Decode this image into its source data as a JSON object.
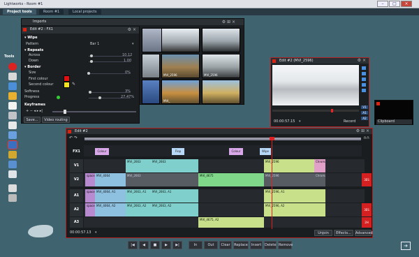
{
  "window": {
    "app_title": "Lightworks - Room #1",
    "controls": [
      "minimize",
      "maximize",
      "close"
    ]
  },
  "tabs": [
    "Project tools",
    "Room #1",
    "Local projects"
  ],
  "toolbox": {
    "label": "Tools"
  },
  "effects_panel": {
    "title": "Edit #2 : FX1",
    "section_wipe": "Wipe",
    "pattern_label": "Pattern",
    "pattern_value": "Bar 1",
    "repeats_label": "Repeats",
    "across_label": "Across",
    "across_value": "10.12",
    "down_label": "Down",
    "down_value": "1.00",
    "border_label": "Border",
    "size_label": "Size",
    "size_value": "0%",
    "first_colour_label": "First colour",
    "second_colour_label": "Second colour",
    "softness_label": "Softness",
    "softness_value": "3%",
    "progress_label": "Progress",
    "progress_value": "27.47%",
    "keyframes_label": "Keyframes",
    "save_label": "Save...",
    "routing_label": "Video routing",
    "first_colour": "#e01010",
    "second_colour": "#f0e020"
  },
  "imports": {
    "title": "Imports",
    "thumbs": [
      {
        "caption": ""
      },
      {
        "caption": ""
      },
      {
        "caption": ""
      },
      {
        "caption": ""
      },
      {
        "caption": "MVI_2596"
      },
      {
        "caption": "MVI_2596"
      },
      {
        "caption": ""
      },
      {
        "caption": "MVI_"
      },
      {
        "caption": ""
      }
    ]
  },
  "viewer": {
    "title": "Edit #2 (MVI_2596)",
    "timecode": "00:00:57.15",
    "record_label": "Record",
    "side_tags": [
      "V1",
      "A1",
      "A2"
    ]
  },
  "clipboard": {
    "label": "Clipboard"
  },
  "timeline": {
    "title": "Edit #2",
    "timecode": "00:00:57.13",
    "fx_track": "FX1",
    "fx_clips": [
      "Colour",
      "Flop",
      "Colour",
      "Wipe"
    ],
    "tracks": [
      {
        "name": "V1",
        "clips": [
          "MVI_2663",
          "MVI_2663",
          "MVI_2596",
          "Chroma"
        ]
      },
      {
        "name": "V2",
        "clips": [
          "space",
          "MVI_4064",
          "MVI_2663",
          "MVI_4675",
          "MVI_2596",
          "Chroma"
        ]
      },
      {
        "name": "A1",
        "clips": [
          "space",
          "MVI_4064, A1",
          "MVI_2663, A1",
          "MVI_2663, A1",
          "MVI_2596, A1"
        ]
      },
      {
        "name": "A2",
        "clips": [
          "space",
          "MVI_4064, A2",
          "MVI_2663, A2",
          "MVI_2663, A2",
          "MVI_2596, A2"
        ]
      },
      {
        "name": "A3",
        "clips": [
          "MVI_4675, A2"
        ]
      }
    ],
    "right_badges": [
      "3ES",
      "3ES",
      "2H"
    ],
    "unjoin_label": "Unjoin",
    "effects_label": "Effects...",
    "advanced_label": "Advanced"
  },
  "transport": {
    "in_label": "In",
    "out_label": "Out",
    "clear_label": "Clear",
    "replace_label": "Replace",
    "insert_label": "Insert",
    "delete_label": "Delete",
    "remove_label": "Remove"
  }
}
